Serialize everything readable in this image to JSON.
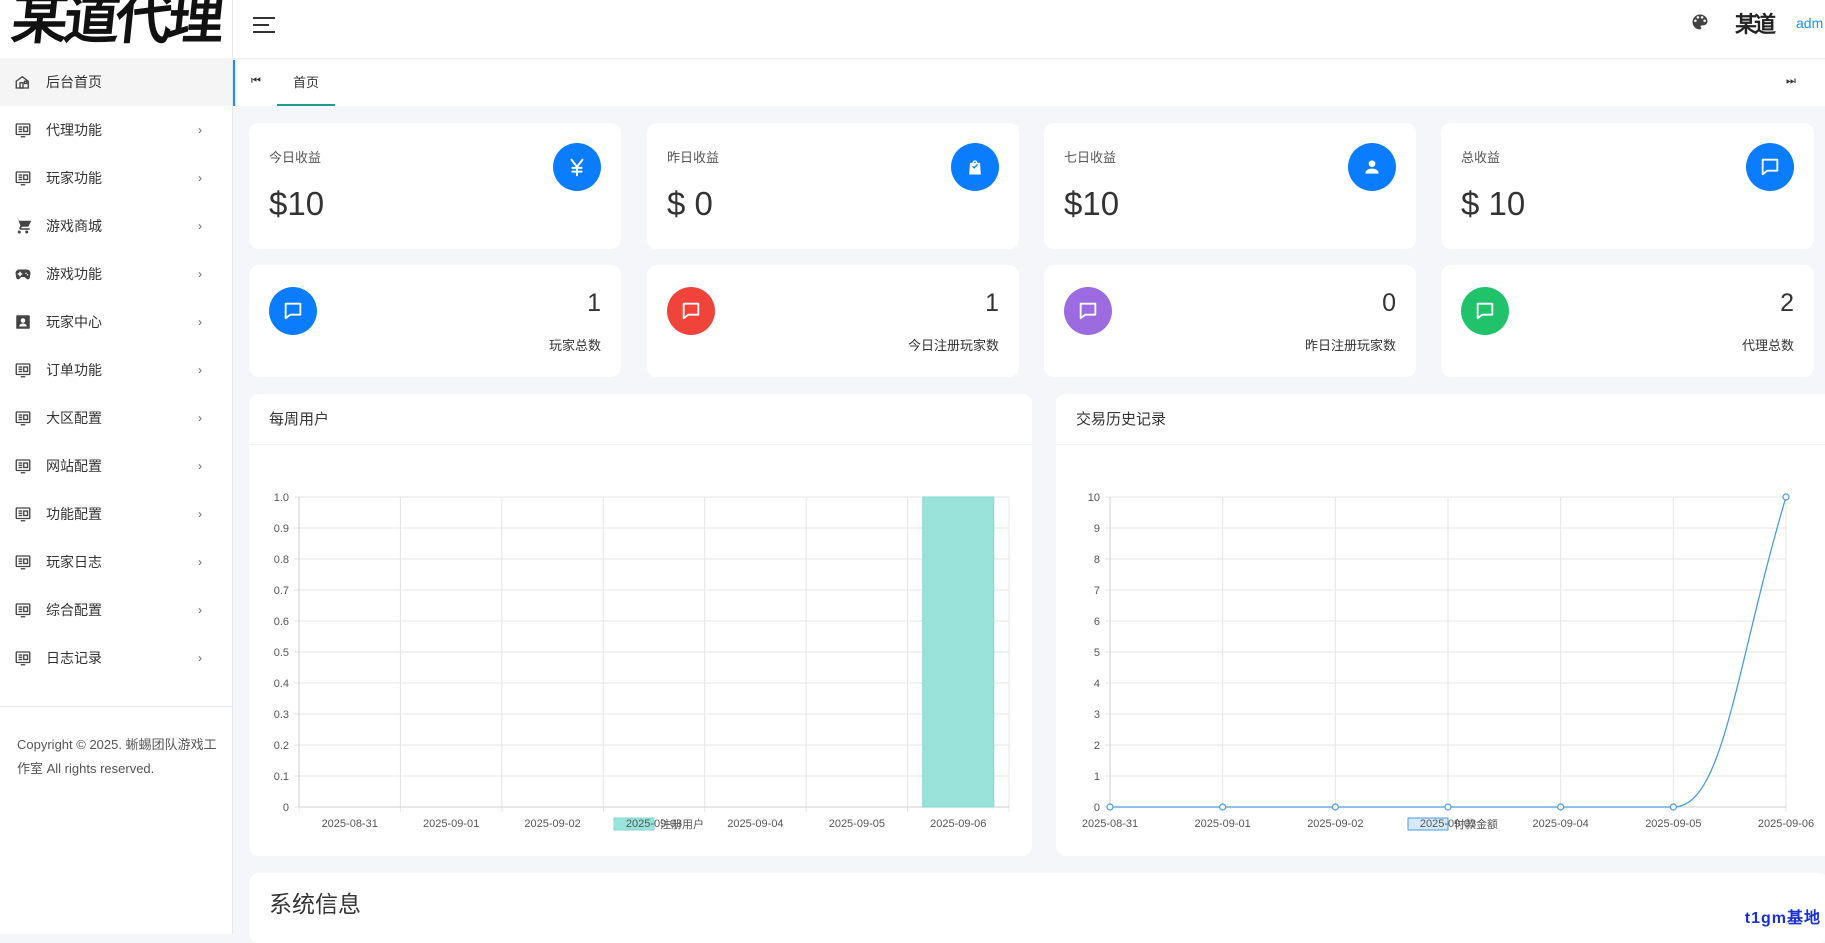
{
  "logo": {
    "text": "某道代理"
  },
  "sidebar": {
    "items": [
      {
        "label": "后台首页",
        "icon": "home-icon",
        "active": true
      },
      {
        "label": "代理功能",
        "icon": "panel-icon"
      },
      {
        "label": "玩家功能",
        "icon": "panel-icon"
      },
      {
        "label": "游戏商城",
        "icon": "cart-icon"
      },
      {
        "label": "游戏功能",
        "icon": "gamepad-icon"
      },
      {
        "label": "玩家中心",
        "icon": "contact-card-icon"
      },
      {
        "label": "订单功能",
        "icon": "panel-icon"
      },
      {
        "label": "大区配置",
        "icon": "panel-icon"
      },
      {
        "label": "网站配置",
        "icon": "panel-icon"
      },
      {
        "label": "功能配置",
        "icon": "panel-icon"
      },
      {
        "label": "玩家日志",
        "icon": "panel-icon"
      },
      {
        "label": "综合配置",
        "icon": "panel-icon"
      },
      {
        "label": "日志记录",
        "icon": "panel-icon"
      }
    ],
    "copyright": "Copyright © 2025. 蜥蜴团队游戏工作室 All rights reserved."
  },
  "topbar": {
    "avatar_text": "某道代理",
    "username": "adm"
  },
  "tabs": {
    "prev_symbol": "⏮",
    "next_symbol": "⏭",
    "items": [
      {
        "label": "首页"
      }
    ]
  },
  "stats": [
    {
      "title": "今日收益",
      "value": "$10",
      "icon": "yen-icon",
      "color": "#0a7cff"
    },
    {
      "title": "昨日收益",
      "value": "$ 0",
      "icon": "shopping-bag-icon",
      "color": "#0a7cff"
    },
    {
      "title": "七日收益",
      "value": "$10",
      "icon": "user-icon",
      "color": "#0a7cff"
    },
    {
      "title": "总收益",
      "value": "$ 10",
      "icon": "chat-icon",
      "color": "#0a7cff"
    }
  ],
  "counts": [
    {
      "value": "1",
      "label": "玩家总数",
      "icon": "chat-icon",
      "color": "#0a7cff"
    },
    {
      "value": "1",
      "label": "今日注册玩家数",
      "icon": "chat-icon",
      "color": "#f0443a"
    },
    {
      "value": "0",
      "label": "昨日注册玩家数",
      "icon": "chat-icon",
      "color": "#9b6bdf"
    },
    {
      "value": "2",
      "label": "代理总数",
      "icon": "chat-icon",
      "color": "#20c26a"
    }
  ],
  "panels": {
    "weekly_title": "每周用户",
    "trade_title": "交易历史记录"
  },
  "chart_data": [
    {
      "type": "bar",
      "title": "每周用户",
      "categories": [
        "2025-08-31",
        "2025-09-01",
        "2025-09-02",
        "2025-09-03",
        "2025-09-04",
        "2025-09-05",
        "2025-09-06"
      ],
      "series": [
        {
          "name": "注册用户",
          "values": [
            0,
            0,
            0,
            0,
            0,
            0,
            1
          ]
        }
      ],
      "ylim": [
        0,
        1.0
      ],
      "yticks": [
        "0",
        "0.1",
        "0.2",
        "0.3",
        "0.4",
        "0.5",
        "0.6",
        "0.7",
        "0.8",
        "0.9",
        "1.0"
      ],
      "colors": {
        "fill": "#99e3db",
        "border": "#7fd8ce"
      },
      "legend": "top-center",
      "grid": true
    },
    {
      "type": "line",
      "title": "交易历史记录",
      "categories": [
        "2025-08-31",
        "2025-09-01",
        "2025-09-02",
        "2025-09-03",
        "2025-09-04",
        "2025-09-05",
        "2025-09-06"
      ],
      "series": [
        {
          "name": "付款金额",
          "values": [
            0,
            0,
            0,
            0,
            0,
            0,
            10
          ]
        }
      ],
      "ylim": [
        0,
        10
      ],
      "yticks": [
        "0",
        "1",
        "2",
        "3",
        "4",
        "5",
        "6",
        "7",
        "8",
        "9",
        "10"
      ],
      "colors": {
        "line": "#4a9be0",
        "legend_fill": "#d6e9f8"
      },
      "legend": "top-center",
      "grid": true
    }
  ],
  "sysinfo": {
    "title": "系统信息"
  },
  "watermark": "t1gm基地"
}
